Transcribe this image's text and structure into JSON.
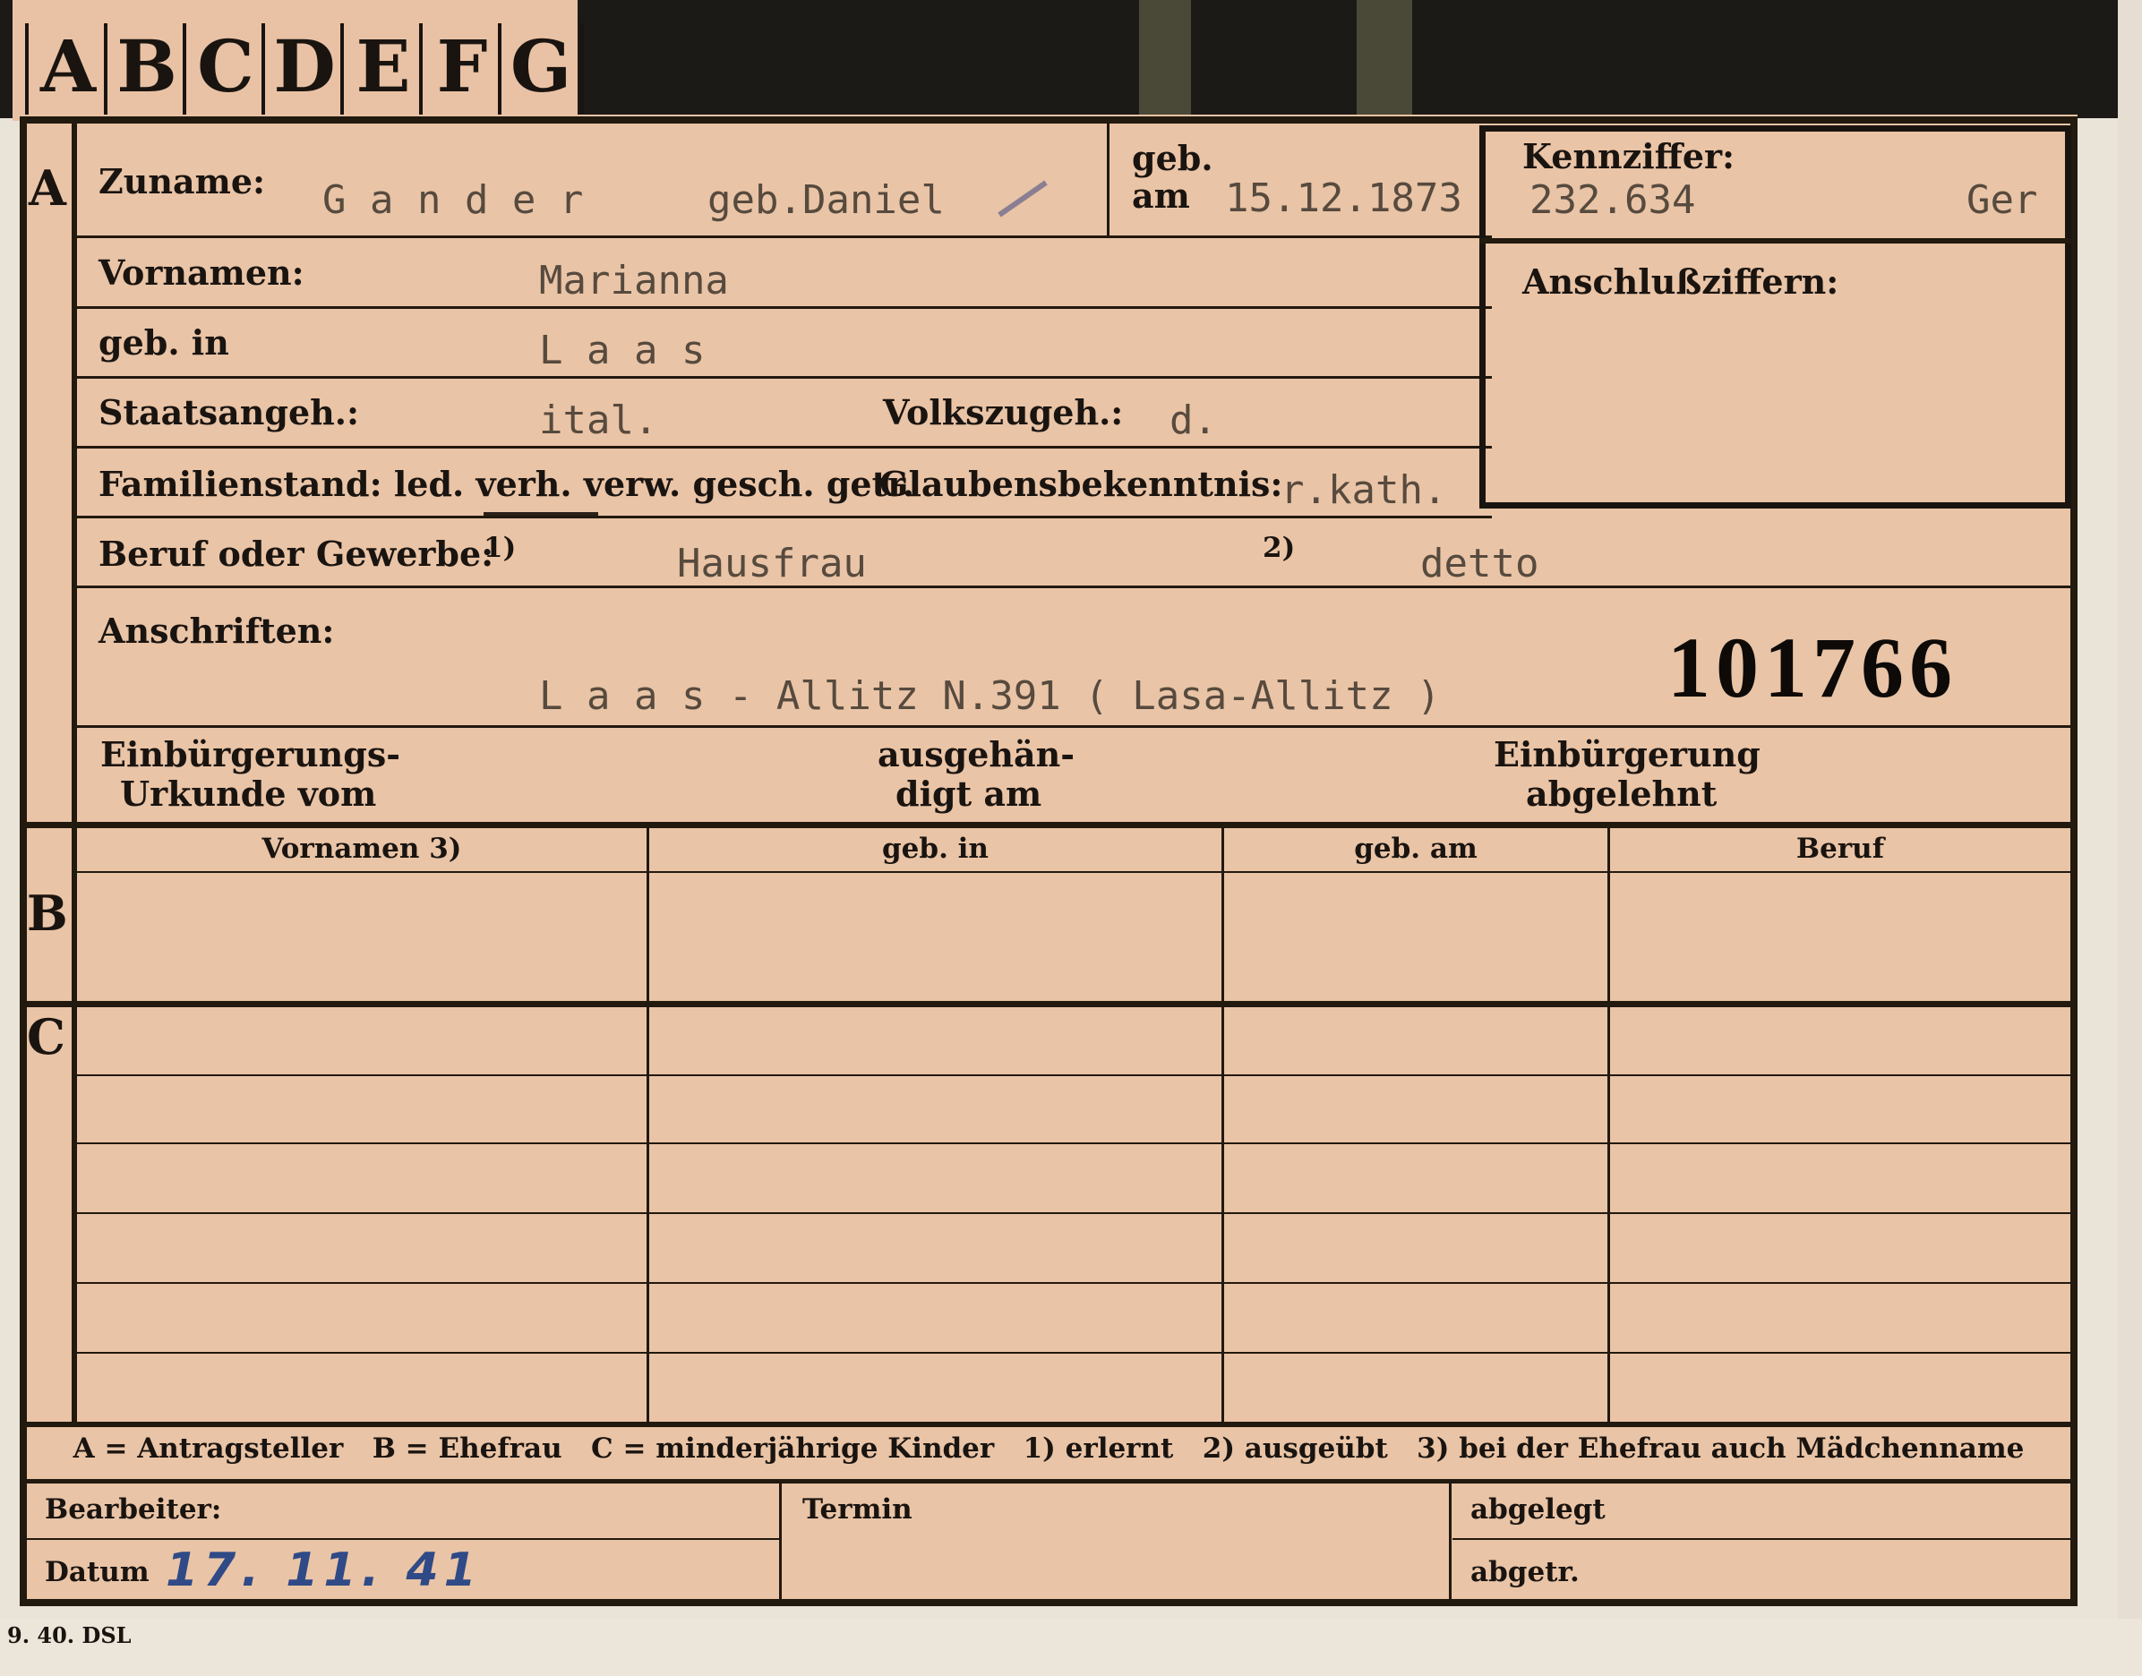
{
  "tabs": [
    "A",
    "B",
    "C",
    "D",
    "E",
    "F",
    "G"
  ],
  "sections": {
    "a": "A",
    "b": "B",
    "c": "C"
  },
  "applicant": {
    "surname_label": "Zuname:",
    "surname": "G a n d e r",
    "maiden_name": "geb.Daniel",
    "birth_date_label_1": "geb.",
    "birth_date_label_2": "am",
    "birth_date": "15.12.1873",
    "given_names_label": "Vornamen:",
    "given_names": "Marianna",
    "birthplace_label": "geb. in",
    "birthplace": "L a a s",
    "citizenship_label": "Staatsangeh.:",
    "citizenship": "ital.",
    "ethnicity_label": "Volkszugeh.:",
    "ethnicity": "d.",
    "marital_status_label": "Familienstand: led. verh. verw. gesch. getr.",
    "religion_label": "Glaubensbekenntnis:",
    "religion": "r.kath.",
    "occupation_label": "Beruf oder Gewerbe:",
    "occupation_note_1": "1)",
    "occupation_learned": "Hausfrau",
    "occupation_note_2": "2)",
    "occupation_practiced": "detto",
    "addresses_label": "Anschriften:",
    "address": "L a a s - Allitz N.391 ( Lasa-Allitz )",
    "naturalization_doc_label_1": "Einbürgerungs-",
    "naturalization_doc_label_2": "Urkunde vom",
    "handed_over_label_1": "ausgehän-",
    "handed_over_label_2": "digt am",
    "naturalization_refused_label_1": "Einbürgerung",
    "naturalization_refused_label_2": "abgelehnt"
  },
  "reference": {
    "code_label": "Kennziffer:",
    "code": "232.634",
    "code_suffix": "Ger",
    "linked_codes_label": "Anschlußziffern:"
  },
  "archive_number": "101766",
  "spouse_table": {
    "headers": [
      "Vornamen 3)",
      "geb. in",
      "geb. am",
      "Beruf"
    ]
  },
  "legend": "A = Antragsteller   B = Ehefrau   C = minderjährige Kinder   1) erlernt   2) ausgeübt   3) bei der Ehefrau auch Mädchenname",
  "footer": {
    "clerk_label": "Bearbeiter:",
    "date_label": "Datum",
    "date_value": "17. 11. 41",
    "deadline_label": "Termin",
    "filed_label": "abgelegt",
    "separated_label": "abgetr.",
    "print_code": "9. 40. DSL"
  }
}
